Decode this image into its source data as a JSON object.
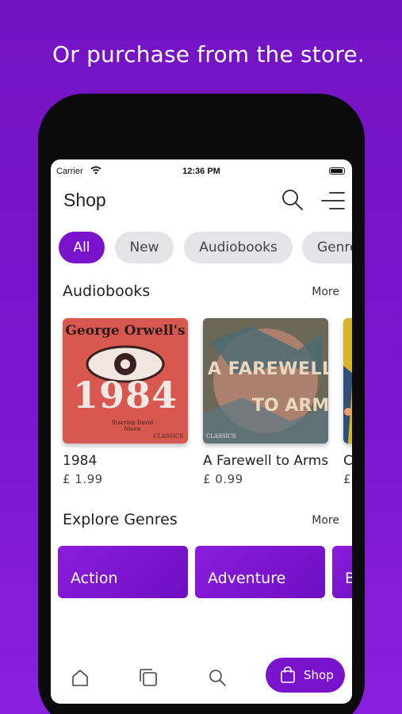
{
  "headline": "Or purchase from the store.",
  "status_bar": {
    "carrier": "Carrier",
    "time": "12:36 PM"
  },
  "nav": {
    "title": "Shop",
    "search_icon": "search-icon",
    "menu_icon": "menu-icon"
  },
  "chips": [
    {
      "label": "All",
      "active": true
    },
    {
      "label": "New",
      "active": false
    },
    {
      "label": "Audiobooks",
      "active": false
    },
    {
      "label": "Genres",
      "active": false
    }
  ],
  "audiobooks": {
    "title": "Audiobooks",
    "more": "More",
    "items": [
      {
        "title": "1984",
        "price": "£ 1.99",
        "cover_author": "George Orwell's",
        "cover_title": "1984",
        "cover_note": "Starring David Niven",
        "cover_badge": "CLASSICS"
      },
      {
        "title": "A Farewell to Arms",
        "price": "£ 0.99",
        "cover_title_line1": "A FAREWELL",
        "cover_title_line2": "TO ARMS",
        "cover_badge": "CLASSICS"
      },
      {
        "title": "C",
        "price": "£"
      }
    ]
  },
  "genres": {
    "title": "Explore Genres",
    "more": "More",
    "items": [
      "Action",
      "Adventure",
      "B"
    ]
  },
  "tabbar": {
    "items": [
      "home-icon",
      "library-icon",
      "search-icon"
    ],
    "shop_label": "Shop"
  },
  "colors": {
    "accent": "#7a14cc",
    "background": "#7413c4",
    "chip_inactive": "#e4e4e6"
  }
}
